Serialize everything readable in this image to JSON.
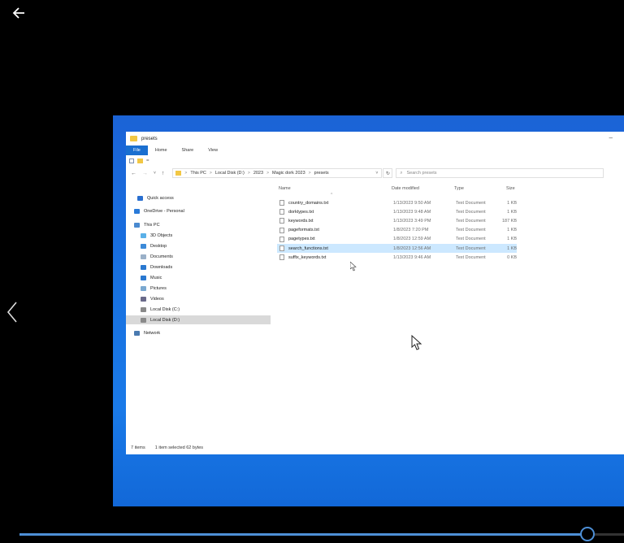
{
  "player": {
    "progress_fraction": 0.94,
    "accent_color": "#4d8fd6"
  },
  "explorer": {
    "window_title": "presets",
    "ribbon_tabs": [
      "File",
      "Home",
      "Share",
      "View"
    ],
    "qat_symbol": "=",
    "nav_back_icon": "←",
    "nav_forward_icon": "→",
    "nav_recent_icon": "˅",
    "nav_up_icon": "↑",
    "breadcrumb": [
      "This PC",
      "Local Disk (D:)",
      "2023",
      "Magic dork 2023",
      "presets"
    ],
    "breadcrumb_sep": ">",
    "breadcrumb_dropdown_icon": "˅",
    "refresh_icon": "↻",
    "search_icon": "⌕",
    "search_placeholder": "Search presets",
    "nav_pane": [
      {
        "label": "Quick access",
        "icon": "star-icon",
        "color": "#2a6fd0"
      },
      {
        "label": "OneDrive - Personal",
        "icon": "cloud-icon",
        "color": "#2a7ad8"
      },
      {
        "label": "This PC",
        "icon": "computer-icon",
        "color": "#4a8ad0"
      },
      {
        "label": "3D Objects",
        "icon": "cube-icon",
        "color": "#5ab0e8"
      },
      {
        "label": "Desktop",
        "icon": "desktop-icon",
        "color": "#3c8ad8"
      },
      {
        "label": "Documents",
        "icon": "document-icon",
        "color": "#9ab0c8"
      },
      {
        "label": "Downloads",
        "icon": "download-icon",
        "color": "#2a78d0"
      },
      {
        "label": "Music",
        "icon": "music-icon",
        "color": "#2a78d0"
      },
      {
        "label": "Pictures",
        "icon": "pictures-icon",
        "color": "#7aa8d0"
      },
      {
        "label": "Videos",
        "icon": "videos-icon",
        "color": "#6a6a8a"
      },
      {
        "label": "Local Disk (C:)",
        "icon": "drive-icon",
        "color": "#8a8a8a"
      },
      {
        "label": "Local Disk (D:)",
        "icon": "drive-icon",
        "color": "#8a8a8a"
      },
      {
        "label": "Network",
        "icon": "network-icon",
        "color": "#4a7ab0"
      }
    ],
    "columns": {
      "name": "Name",
      "date": "Date modified",
      "type": "Type",
      "size": "Size"
    },
    "files": [
      {
        "name": "country_domains.txt",
        "date": "1/13/2023 9:50 AM",
        "type": "Text Document",
        "size": "1 KB"
      },
      {
        "name": "dorktypes.txt",
        "date": "1/13/2023 9:48 AM",
        "type": "Text Document",
        "size": "1 KB"
      },
      {
        "name": "keywords.txt",
        "date": "1/13/2023 3:49 PM",
        "type": "Text Document",
        "size": "187 KB"
      },
      {
        "name": "pageformats.txt",
        "date": "1/8/2023 7:20 PM",
        "type": "Text Document",
        "size": "1 KB"
      },
      {
        "name": "pagetypes.txt",
        "date": "1/8/2023 12:59 AM",
        "type": "Text Document",
        "size": "1 KB"
      },
      {
        "name": "search_functions.txt",
        "date": "1/8/2023 12:56 AM",
        "type": "Text Document",
        "size": "1 KB"
      },
      {
        "name": "suffix_keywords.txt",
        "date": "1/13/2023 9:46 AM",
        "type": "Text Document",
        "size": "0 KB"
      }
    ],
    "selected_file_index": 5,
    "status": {
      "count": "7 items",
      "selection": "1 item selected  62 bytes"
    }
  }
}
